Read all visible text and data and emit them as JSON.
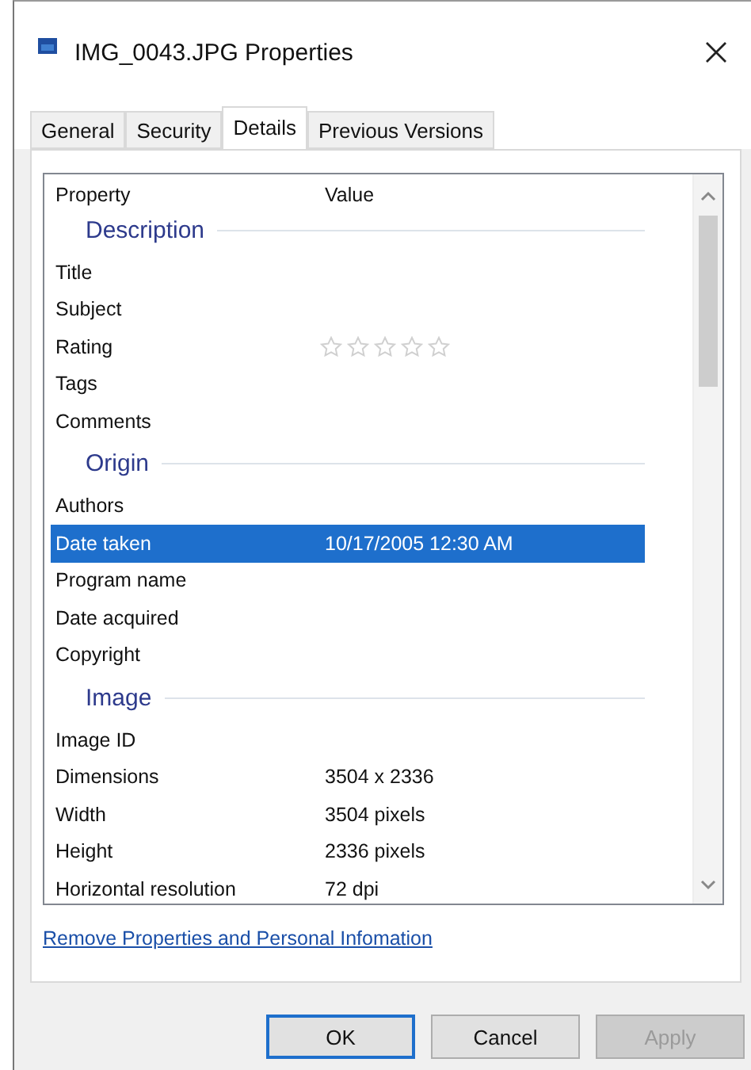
{
  "window": {
    "title": "IMG_0043.JPG Properties"
  },
  "tabs": [
    {
      "label": "General",
      "selected": false
    },
    {
      "label": "Security",
      "selected": false
    },
    {
      "label": "Details",
      "selected": true
    },
    {
      "label": "Previous Versions",
      "selected": false
    }
  ],
  "list": {
    "columns": [
      "Property",
      "Value"
    ],
    "items": [
      {
        "kind": "group",
        "label": "Description"
      },
      {
        "kind": "row",
        "property": "Title",
        "selected": false
      },
      {
        "kind": "row",
        "property": "Subject",
        "selected": false
      },
      {
        "kind": "rating",
        "property": "Rating",
        "stars": 0,
        "selected": false
      },
      {
        "kind": "row",
        "property": "Tags",
        "selected": false
      },
      {
        "kind": "row",
        "property": "Comments",
        "selected": false
      },
      {
        "kind": "group",
        "label": "Origin"
      },
      {
        "kind": "row",
        "property": "Authors",
        "selected": false
      },
      {
        "kind": "row",
        "property": "Date taken",
        "value": "10/17/2005 12:30 AM",
        "selected": true
      },
      {
        "kind": "row",
        "property": "Program name",
        "selected": false
      },
      {
        "kind": "row",
        "property": "Date acquired",
        "selected": false
      },
      {
        "kind": "row",
        "property": "Copyright",
        "selected": false
      },
      {
        "kind": "group",
        "label": "Image"
      },
      {
        "kind": "row",
        "property": "Image ID",
        "selected": false
      },
      {
        "kind": "row",
        "property": "Dimensions",
        "value": "3504 x 2336",
        "selected": false
      },
      {
        "kind": "row",
        "property": "Width",
        "value": "3504 pixels",
        "selected": false
      },
      {
        "kind": "row",
        "property": "Height",
        "value": "2336 pixels",
        "selected": false
      },
      {
        "kind": "row",
        "property": "Horizontal resolution",
        "value": "72 dpi",
        "selected": false
      }
    ]
  },
  "link": "Remove Properties and Personal Infomation",
  "buttons": [
    {
      "label": "OK",
      "default": true,
      "disabled": false
    },
    {
      "label": "Cancel",
      "default": false,
      "disabled": false
    },
    {
      "label": "Apply",
      "default": false,
      "disabled": true
    }
  ]
}
